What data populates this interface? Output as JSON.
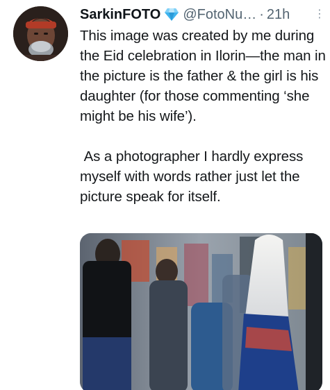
{
  "tweet": {
    "display_name": "SarkinFOTO",
    "handle": "@FotoNu…",
    "separator": "·",
    "time": "21h",
    "more_glyph": "⋮",
    "paragraphs": [
      "This image was created by me during the Eid celebration in Ilorin—the man in the picture is the father & the girl is his daughter (for those commenting ‘she might be his wife’).",
      " As a photographer I hardly express myself with words rather just let the picture speak for itself."
    ]
  },
  "icons": {
    "verified": "blue-diamond-icon",
    "more": "more-options-icon"
  },
  "colors": {
    "accent": "#1d9bf0",
    "muted": "#536471",
    "text": "#14171a"
  }
}
